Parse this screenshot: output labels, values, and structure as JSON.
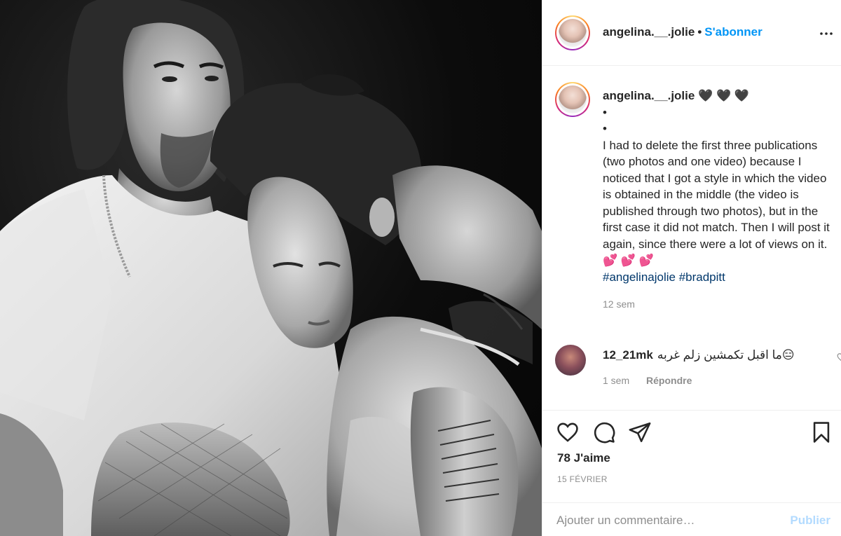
{
  "header": {
    "username": "angelina.__.jolie",
    "separator": "•",
    "follow_label": "S'abonner"
  },
  "caption": {
    "username": "angelina.__.jolie",
    "emoji": "🖤 🖤 🖤",
    "bullet_1": "•",
    "bullet_2": "•",
    "text": "I had to delete the first three publications (two photos and one video) because I noticed that I got a style in which the video is obtained in the middle (the video is published through two photos), but in the first case it did not match. Then I will post it again, since there were a lot of views on it.💕 💕 💕",
    "hashtags": "#angelinajolie #bradpitt",
    "time": "12 sem"
  },
  "reply": {
    "username": "12_21mk",
    "text": "ما اقبل تكمشين زلم غربه😑",
    "time": "1 sem",
    "reply_label": "Répondre"
  },
  "actions": {
    "likes": "78 J'aime",
    "date": "15 FÉVRIER"
  },
  "comment_box": {
    "placeholder": "Ajouter un commentaire…",
    "post_label": "Publier"
  },
  "icons": {
    "like": "heart-icon",
    "comment": "comment-icon",
    "share": "paper-plane-icon",
    "save": "bookmark-icon",
    "more": "more-dots-icon"
  },
  "colors": {
    "accent": "#0095f6",
    "hashtag": "#00376b",
    "muted": "#8e8e8e",
    "post_disabled": "#b3dbff"
  }
}
